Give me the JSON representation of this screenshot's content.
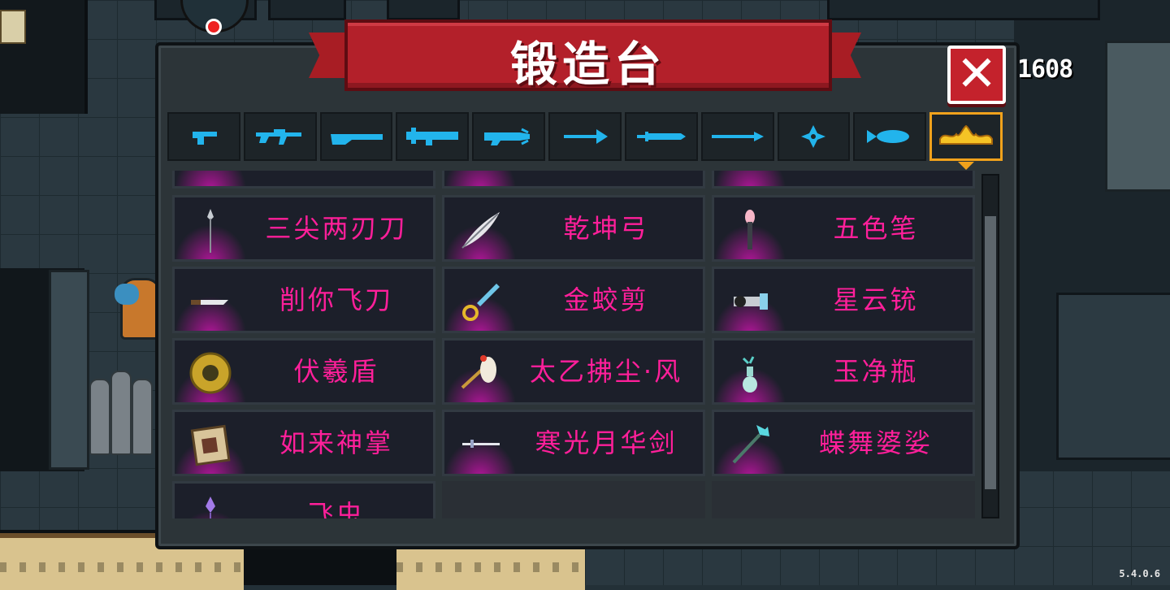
{
  "header": {
    "title": "锻造台",
    "close_label": "✕"
  },
  "currency": {
    "gems": "1608"
  },
  "version": "5.4.0.6",
  "tabs": [
    {
      "icon": "pistol-icon",
      "active": false
    },
    {
      "icon": "rifle-icon",
      "active": false
    },
    {
      "icon": "shotgun-icon",
      "active": false
    },
    {
      "icon": "launcher-icon",
      "active": false
    },
    {
      "icon": "laser-icon",
      "active": false
    },
    {
      "icon": "bow-icon",
      "active": false
    },
    {
      "icon": "sword-icon",
      "active": false
    },
    {
      "icon": "spear-icon",
      "active": false
    },
    {
      "icon": "shuriken-icon",
      "active": false
    },
    {
      "icon": "fish-icon",
      "active": false
    },
    {
      "icon": "crown-icon",
      "active": true
    }
  ],
  "weapons": [
    [
      "三尖两刃刀",
      "乾坤弓",
      "五色笔"
    ],
    [
      "削你飞刀",
      "金蛟剪",
      "星云铳"
    ],
    [
      "伏羲盾",
      "太乙拂尘·风",
      "玉净瓶"
    ],
    [
      "如来神掌",
      "寒光月华剑",
      "蝶舞婆娑"
    ],
    [
      "飞虫"
    ]
  ],
  "colors": {
    "accent": "#ff1f9a",
    "tab_icon": "#22b4ec",
    "active_tab": "#f0a21c",
    "banner": "#b3202a"
  }
}
